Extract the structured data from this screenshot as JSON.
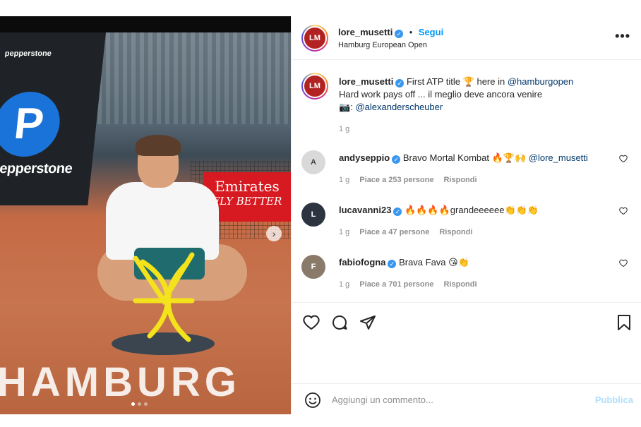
{
  "header": {
    "username": "lore_musetti",
    "follow_label": "Segui",
    "location": "Hamburg European Open",
    "more_icon": "more-horizontal-icon"
  },
  "caption": {
    "username": "lore_musetti",
    "text_1": "First ATP title",
    "text_2": "here in",
    "mention_1": "@hamburgopen",
    "line2": "Hard work pays off ... il meglio deve ancora venire",
    "camera_label": ":",
    "mention_2": "@alexanderscheuber",
    "time": "1 g"
  },
  "comments": [
    {
      "username": "andyseppio",
      "text": "Bravo Mortal Kombat 🔥🏆🙌",
      "mention": "@lore_musetti",
      "time": "1 g",
      "likes": "Piace a 253 persone",
      "reply": "Rispondi"
    },
    {
      "username": "lucavanni23",
      "text": "🔥🔥🔥🔥grandeeeeee👏👏👏",
      "time": "1 g",
      "likes": "Piace a 47 persone",
      "reply": "Rispondi"
    },
    {
      "username": "fabiofogna",
      "text": "Brava Fava 😘👏",
      "time": "1 g",
      "likes": "Piace a 701 persone",
      "reply": "Rispondi"
    }
  ],
  "media": {
    "sponsor_small": "pepperstone",
    "sponsor_big": "pepperstone",
    "sponsor_letter": "P",
    "emirates_1": "Emirates",
    "emirates_2": "FLY BETTER",
    "court_text": "HAMBURG",
    "next_icon": "›"
  },
  "composer": {
    "placeholder": "Aggiungi un commento...",
    "publish_label": "Pubblica"
  },
  "colors": {
    "accent": "#0095f6",
    "verified": "#3897f0",
    "emirates_red": "#d71a21",
    "pepperstone_blue": "#1a73d9"
  }
}
